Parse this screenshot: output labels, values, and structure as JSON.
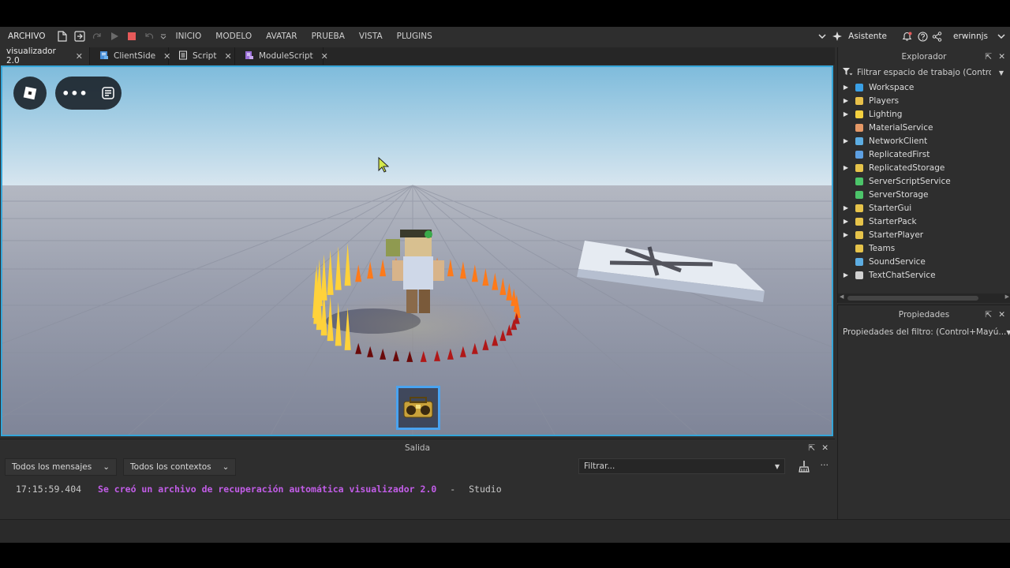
{
  "menubar": {
    "file": "ARCHIVO",
    "items": [
      "INICIO",
      "MODELO",
      "AVATAR",
      "PRUEBA",
      "VISTA",
      "PLUGINS"
    ],
    "assistant": "Asistente",
    "username": "erwinnjs"
  },
  "tabs": [
    {
      "label": "visualizador 2.0",
      "icon": "none"
    },
    {
      "label": "ClientSide",
      "icon": "local-script-icon"
    },
    {
      "label": "Script",
      "icon": "script-icon"
    },
    {
      "label": "ModuleScript",
      "icon": "module-script-icon"
    }
  ],
  "output": {
    "title": "Salida",
    "filter_messages": "Todos los mensajes",
    "filter_contexts": "Todos los contextos",
    "filter_placeholder": "Filtrar...",
    "log": {
      "timestamp": "17:15:59.404",
      "message": "Se creó un archivo de recuperación automática visualizador 2.0",
      "separator": "-",
      "source": "Studio"
    }
  },
  "explorer": {
    "title": "Explorador",
    "filter": "Filtrar espacio de trabajo (Contro...",
    "items": [
      {
        "label": "Workspace",
        "expandable": true,
        "icon": "workspace-icon",
        "color": "#3aa0e6"
      },
      {
        "label": "Players",
        "expandable": true,
        "icon": "players-icon",
        "color": "#e8c04a"
      },
      {
        "label": "Lighting",
        "expandable": true,
        "icon": "lighting-icon",
        "color": "#f4d03f"
      },
      {
        "label": "MaterialService",
        "expandable": false,
        "icon": "material-service-icon",
        "color": "#e59866"
      },
      {
        "label": "NetworkClient",
        "expandable": true,
        "icon": "network-client-icon",
        "color": "#5dade2"
      },
      {
        "label": "ReplicatedFirst",
        "expandable": false,
        "icon": "replicated-first-icon",
        "color": "#5d9fe2"
      },
      {
        "label": "ReplicatedStorage",
        "expandable": true,
        "icon": "replicated-storage-icon",
        "color": "#e6c34a"
      },
      {
        "label": "ServerScriptService",
        "expandable": false,
        "icon": "server-script-service-icon",
        "color": "#4cc46a"
      },
      {
        "label": "ServerStorage",
        "expandable": false,
        "icon": "server-storage-icon",
        "color": "#4cc46a"
      },
      {
        "label": "StarterGui",
        "expandable": true,
        "icon": "starter-gui-icon",
        "color": "#e6c34a"
      },
      {
        "label": "StarterPack",
        "expandable": true,
        "icon": "starter-pack-icon",
        "color": "#e6c34a"
      },
      {
        "label": "StarterPlayer",
        "expandable": true,
        "icon": "starter-player-icon",
        "color": "#e6c34a"
      },
      {
        "label": "Teams",
        "expandable": false,
        "icon": "teams-icon",
        "color": "#e6c34a"
      },
      {
        "label": "SoundService",
        "expandable": false,
        "icon": "sound-service-icon",
        "color": "#5dade2"
      },
      {
        "label": "TextChatService",
        "expandable": true,
        "icon": "text-chat-service-icon",
        "color": "#d0d0d0"
      }
    ]
  },
  "properties": {
    "title": "Propiedades",
    "filter": "Propiedades del filtro: (Control+Mayú..."
  },
  "colors": {
    "accent": "#35a5d8",
    "log_message": "#c25de8",
    "panel_bg": "#2e2e2e"
  }
}
